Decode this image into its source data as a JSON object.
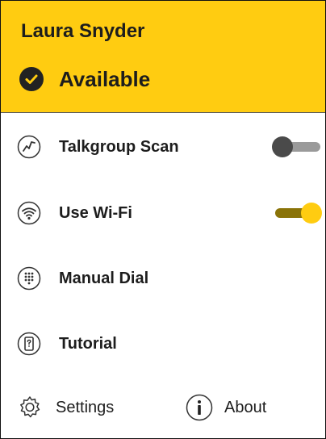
{
  "header": {
    "user_name": "Laura Snyder",
    "status": "Available",
    "accent_color": "#ffcc11"
  },
  "menu": {
    "items": [
      {
        "label": "Talkgroup Scan",
        "icon": "talkgroup-scan-icon",
        "toggle": "off"
      },
      {
        "label": "Use Wi-Fi",
        "icon": "wifi-icon",
        "toggle": "on"
      },
      {
        "label": "Manual Dial",
        "icon": "dialpad-icon"
      },
      {
        "label": "Tutorial",
        "icon": "tutorial-icon"
      }
    ]
  },
  "footer": {
    "settings_label": "Settings",
    "about_label": "About"
  }
}
